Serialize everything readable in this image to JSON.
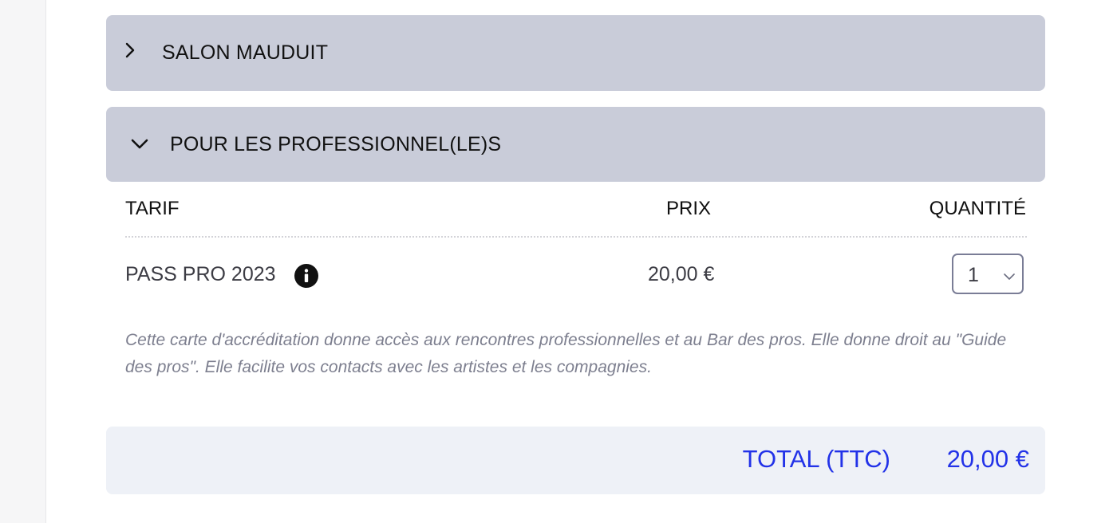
{
  "accordion": {
    "salon": {
      "title": "SALON MAUDUIT",
      "expanded": false,
      "icon": "chevron-right-icon"
    },
    "pros": {
      "title": "POUR LES PROFESSIONNEL(LE)S",
      "expanded": true,
      "icon": "chevron-down-icon"
    }
  },
  "table": {
    "headers": {
      "tarif": "TARIF",
      "prix": "PRIX",
      "quantite": "QUANTITÉ"
    },
    "rows": [
      {
        "tarif": "PASS PRO 2023",
        "info_icon": "info-icon",
        "prix": "20,00 €",
        "quantite": "1",
        "description": "Cette carte d'accréditation donne accès aux rencontres professionnelles et au Bar des pros. Elle donne droit au \"Guide des pros\". Elle facilite vos contacts avec les artistes et les compagnies."
      }
    ]
  },
  "total": {
    "label": "TOTAL (TTC)",
    "value": "20,00 €"
  },
  "colors": {
    "panel_bg": "#c9ccd9",
    "total_bg": "#eef1f7",
    "accent": "#2232e8",
    "description": "#7d7f8f"
  }
}
